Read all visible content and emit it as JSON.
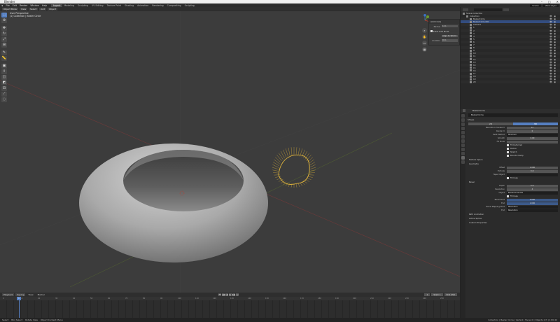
{
  "window": {
    "title": "Blender",
    "controls": [
      "–",
      "□",
      "✕"
    ]
  },
  "menubar": {
    "menus": [
      "File",
      "Edit",
      "Render",
      "Window",
      "Help"
    ],
    "workspaces": [
      "Layout",
      "Modeling",
      "Sculpting",
      "UV Editing",
      "Texture Paint",
      "Shading",
      "Animation",
      "Rendering",
      "Compositing",
      "Scripting"
    ],
    "active_workspace": "Layout",
    "scene": "Scene",
    "view_layer": "View Layer"
  },
  "viewport": {
    "header_buttons": [
      "Object Mode",
      "View",
      "Select",
      "Add",
      "Object"
    ],
    "info_line1": "User Perspective",
    "info_line2": "(1) Collection | Bezier Circle",
    "toolbar_icons": [
      "select-box",
      "cursor",
      "move",
      "rotate",
      "scale",
      "transform",
      "annotate",
      "measure",
      "add-cube",
      "extrude",
      "inset",
      "bevel",
      "loop-cut",
      "knife",
      "smooth"
    ],
    "nav_buttons": [
      "zoom-icon",
      "pan-icon",
      "camera-icon",
      "grid-icon"
    ],
    "gizmo_axes": [
      "X",
      "Y",
      "Z"
    ]
  },
  "redo_panel": {
    "title": "Add Circle",
    "rows": [
      {
        "label": "Radius",
        "value": "1 m"
      },
      {
        "label": "",
        "value": "Align to World"
      },
      {
        "label": "Location",
        "value": "0 m"
      }
    ],
    "checkbox_label": "Enter Edit Mode"
  },
  "timeline": {
    "header_buttons": [
      "Playback",
      "Keying",
      "View",
      "Marker"
    ],
    "playback_controls": [
      "⏮",
      "◀◀",
      "◀",
      "▶",
      "▶▶",
      "⏭"
    ],
    "current_frame": "1",
    "start_frame": "Start 1",
    "end_frame": "End 250",
    "frame_ticks": [
      "0",
      "10",
      "20",
      "30",
      "40",
      "50",
      "60",
      "70",
      "80",
      "90",
      "100",
      "110",
      "120",
      "130",
      "140",
      "150",
      "160",
      "170",
      "180",
      "190",
      "200",
      "210",
      "220",
      "230",
      "240",
      "250"
    ]
  },
  "statusbar": {
    "items": [
      "Select",
      "Box Select",
      "Rotate View",
      "Object Context Menu"
    ],
    "stats": "Collection | Bezier Circle | Verts:0 | Faces:0 | Objects:1/3 | 2.80.44"
  },
  "outliner": {
    "rows": [
      {
        "label": "Scene Collection",
        "indent": 0,
        "selected": false
      },
      {
        "label": "Collection",
        "indent": 1,
        "selected": false
      },
      {
        "label": "BezierCircle",
        "indent": 2,
        "selected": false
      },
      {
        "label": "BezierCircle.001",
        "indent": 2,
        "selected": true
      },
      {
        "label": "Camera",
        "indent": 2,
        "selected": false
      },
      {
        "label": "1",
        "indent": 2,
        "selected": false
      },
      {
        "label": "2",
        "indent": 2,
        "selected": false
      },
      {
        "label": "3",
        "indent": 2,
        "selected": false
      },
      {
        "label": "4",
        "indent": 2,
        "selected": false
      },
      {
        "label": "5",
        "indent": 2,
        "selected": false
      },
      {
        "label": "6",
        "indent": 2,
        "selected": false
      },
      {
        "label": "7",
        "indent": 2,
        "selected": false
      },
      {
        "label": "8",
        "indent": 2,
        "selected": false
      },
      {
        "label": "9",
        "indent": 2,
        "selected": false
      },
      {
        "label": "10",
        "indent": 2,
        "selected": false
      },
      {
        "label": "11",
        "indent": 2,
        "selected": false
      },
      {
        "label": "12",
        "indent": 2,
        "selected": false
      },
      {
        "label": "13",
        "indent": 2,
        "selected": false
      },
      {
        "label": "14",
        "indent": 2,
        "selected": false
      },
      {
        "label": "15",
        "indent": 2,
        "selected": false
      },
      {
        "label": "16",
        "indent": 2,
        "selected": false
      },
      {
        "label": "17",
        "indent": 2,
        "selected": false
      },
      {
        "label": "18",
        "indent": 2,
        "selected": false
      },
      {
        "label": "19",
        "indent": 2,
        "selected": false
      },
      {
        "label": "20",
        "indent": 2,
        "selected": false
      }
    ],
    "visibility_icons": "👁 ◉"
  },
  "properties": {
    "object_name": "BezierCircle",
    "name_field": "BezierCircle",
    "shape_title": "Shape",
    "shape_modes": [
      "2D",
      "3D"
    ],
    "active_shape_mode": "3D",
    "shape_rows": [
      {
        "label": "Resolution Preview U",
        "value": "12"
      },
      {
        "label": "Render U",
        "value": "0"
      },
      {
        "label": "Twist Method",
        "value": "Minimum"
      },
      {
        "label": "Smooth",
        "value": "0.00"
      }
    ],
    "fill_mode_label": "Fill Mode",
    "checkboxes": [
      "Radius",
      "Stretch",
      "Bounds Clamp"
    ],
    "fill_deform_label": "Fill Deformed",
    "sections": [
      "Texture Space",
      "Geometry"
    ],
    "geometry_rows": [
      {
        "label": "Offset",
        "value": "1.000"
      },
      {
        "label": "Extrude",
        "value": "0 m"
      },
      {
        "label": "Taper Object",
        "value": ""
      }
    ],
    "fill_caps_label": "Fill Caps",
    "bevel_title": "Bevel",
    "bevel_rows": [
      {
        "label": "Depth",
        "value": "0 m"
      },
      {
        "label": "Resolution",
        "value": "4"
      },
      {
        "label": "Object",
        "value": "BezierCircle.001"
      }
    ],
    "bevel_fill_caps": "Fill Caps",
    "bevel_factor_rows": [
      {
        "label": "Bevel Start",
        "value": "0.000"
      },
      {
        "label": "End",
        "value": "1.000"
      },
      {
        "label": "Bevel Mapping Start",
        "value": "Resolution"
      },
      {
        "label": "End",
        "value": "Resolution"
      }
    ],
    "bottom_sections": [
      "Path Animation",
      "Active Spline",
      "Custom Properties"
    ]
  },
  "colors": {
    "accent": "#5680c2",
    "viewport_bg": "#3c3c3c",
    "torus_light": "#b4b4b4",
    "torus_dark": "#6e6e6e",
    "curve": "#e3b73c"
  }
}
